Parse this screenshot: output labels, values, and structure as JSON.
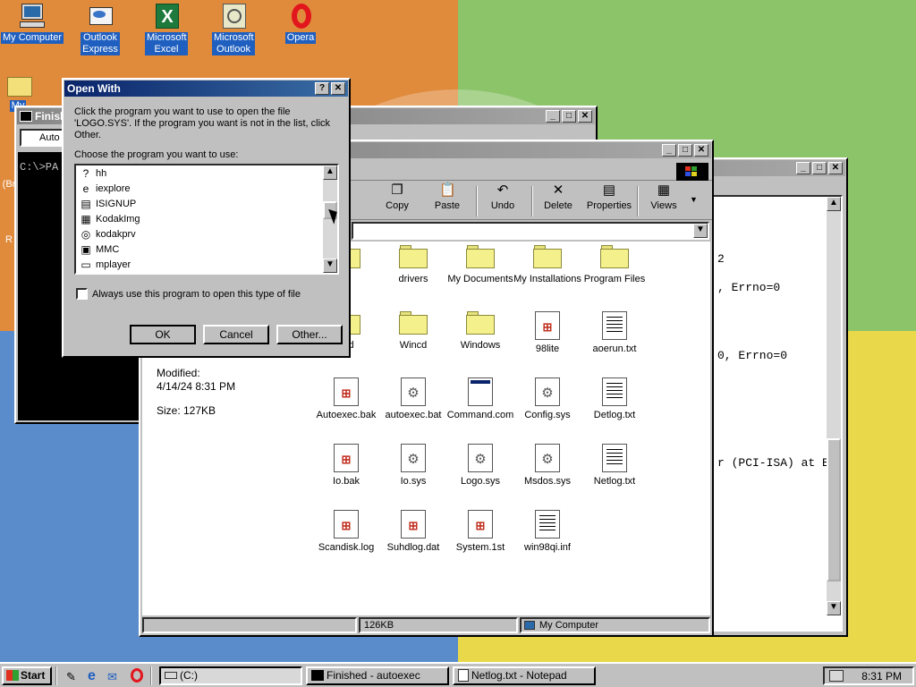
{
  "desktop": {
    "icons": [
      {
        "label": "My Computer"
      },
      {
        "label": "Outlook Express"
      },
      {
        "label": "Microsoft Excel"
      },
      {
        "label": "Microsoft Outlook"
      },
      {
        "label": "Opera"
      },
      {
        "label": "My"
      },
      {
        "label": "(Br"
      },
      {
        "label": "R"
      }
    ]
  },
  "dos_window": {
    "title": "Finish",
    "font_label": "Auto",
    "prompt": "C:\\>PA"
  },
  "explorer_window": {
    "toolbar": [
      "Copy",
      "Paste",
      "Undo",
      "Delete",
      "Properties",
      "Views"
    ],
    "details": {
      "modified_label": "Modified:",
      "modified_value": "4/14/24 8:31 PM",
      "size_label": "Size: 127KB"
    },
    "files": [
      {
        "name": "er",
        "type": "folder"
      },
      {
        "name": "drivers",
        "type": "folder"
      },
      {
        "name": "My Documents",
        "type": "folder"
      },
      {
        "name": "My Installations",
        "type": "folder"
      },
      {
        "name": "Program Files",
        "type": "folder"
      },
      {
        "name": "lled",
        "type": "folder"
      },
      {
        "name": "Wincd",
        "type": "folder"
      },
      {
        "name": "Windows",
        "type": "folder"
      },
      {
        "name": "98lite",
        "type": "winlogo"
      },
      {
        "name": "aoerun.txt",
        "type": "txt"
      },
      {
        "name": "Autoexec.bak",
        "type": "winlogo"
      },
      {
        "name": "autoexec.bat",
        "type": "gear"
      },
      {
        "name": "Command.com",
        "type": "exe"
      },
      {
        "name": "Config.sys",
        "type": "gear"
      },
      {
        "name": "Detlog.txt",
        "type": "txt"
      },
      {
        "name": "Io.bak",
        "type": "winlogo"
      },
      {
        "name": "Io.sys",
        "type": "gear"
      },
      {
        "name": "Logo.sys",
        "type": "gear"
      },
      {
        "name": "Msdos.sys",
        "type": "gear"
      },
      {
        "name": "Netlog.txt",
        "type": "txt"
      },
      {
        "name": "Scandisk.log",
        "type": "winlogo"
      },
      {
        "name": "Suhdlog.dat",
        "type": "winlogo"
      },
      {
        "name": "System.1st",
        "type": "winlogo"
      },
      {
        "name": "win98qi.inf",
        "type": "txt"
      }
    ],
    "status": {
      "size": "126KB",
      "location": "My Computer"
    }
  },
  "notepad_window": {
    "lines": [
      "2",
      ", Errno=0",
      "0, Errno=0",
      "r (PCI-ISA) at Er"
    ]
  },
  "open_with": {
    "title": "Open With",
    "help_btn": "?",
    "close_btn": "✕",
    "instruction": "Click the program you want to use to open the file 'LOGO.SYS'. If the program you want is not in the list, click Other.",
    "choose_label": "Choose the program you want to use:",
    "programs": [
      {
        "name": "hh",
        "icon": "?"
      },
      {
        "name": "iexplore",
        "icon": "e"
      },
      {
        "name": "ISIGNUP",
        "icon": "▤"
      },
      {
        "name": "KodakImg",
        "icon": "▦"
      },
      {
        "name": "kodakprv",
        "icon": "◎"
      },
      {
        "name": "MMC",
        "icon": "▣"
      },
      {
        "name": "mplayer",
        "icon": "▭"
      }
    ],
    "always_use_label": "Always use this program to open this type of file",
    "ok": "OK",
    "cancel": "Cancel",
    "other": "Other..."
  },
  "taskbar": {
    "start": "Start",
    "tasks": [
      "(C:)",
      "Finished - autoexec",
      "Netlog.txt - Notepad"
    ],
    "clock": "8:31 PM"
  }
}
